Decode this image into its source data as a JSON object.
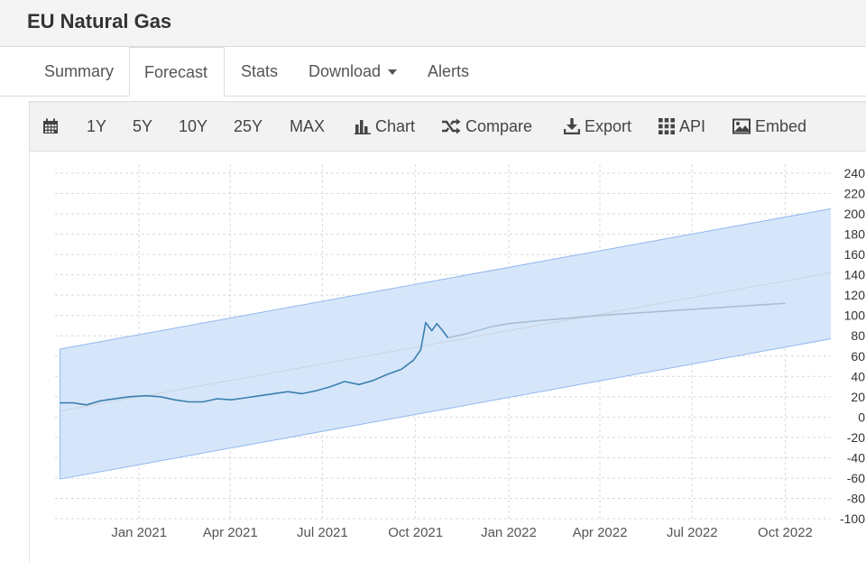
{
  "header": {
    "title": "EU Natural Gas"
  },
  "tabs": [
    {
      "label": "Summary",
      "active": false
    },
    {
      "label": "Forecast",
      "active": true
    },
    {
      "label": "Stats",
      "active": false
    },
    {
      "label": "Download",
      "active": false
    },
    {
      "label": "Alerts",
      "active": false
    }
  ],
  "toolbar": {
    "calendar_icon": "calendar-icon",
    "ranges": [
      "1Y",
      "5Y",
      "10Y",
      "25Y",
      "MAX"
    ],
    "chart_label": "Chart",
    "compare_label": "Compare",
    "export_label": "Export",
    "api_label": "API",
    "embed_label": "Embed"
  },
  "colors": {
    "band_fill": "#d6e6fa",
    "band_stroke": "#8fb8ee",
    "history_line": "#3a7fb0",
    "forecast_line": "#a9bfd4",
    "trend_line": "#c9d3dd",
    "grid": "#d9d9d9"
  },
  "chart_data": {
    "type": "line",
    "x_ticks": [
      "Jan 2021",
      "Apr 2021",
      "Jul 2021",
      "Oct 2021",
      "Jan 2022",
      "Apr 2022",
      "Jul 2022",
      "Oct 2022"
    ],
    "x_tick_dates": [
      "2021-01-01",
      "2021-04-01",
      "2021-07-01",
      "2021-10-01",
      "2022-01-01",
      "2022-04-01",
      "2022-07-01",
      "2022-10-01"
    ],
    "y_ticks": [
      240,
      220,
      200,
      180,
      160,
      140,
      120,
      100,
      80,
      60,
      40,
      20,
      0,
      -20,
      -40,
      -60,
      -80,
      -100
    ],
    "ylim": [
      -100,
      240
    ],
    "xlim": [
      "2020-10-10",
      "2022-11-15"
    ],
    "grid": true,
    "series": [
      {
        "role": "history",
        "x": [
          "2020-10-15",
          "2020-10-28",
          "2020-11-10",
          "2020-11-24",
          "2020-12-08",
          "2020-12-22",
          "2021-01-08",
          "2021-01-22",
          "2021-02-05",
          "2021-02-19",
          "2021-03-05",
          "2021-03-19",
          "2021-04-02",
          "2021-04-16",
          "2021-04-30",
          "2021-05-14",
          "2021-05-28",
          "2021-06-11",
          "2021-06-25",
          "2021-07-09",
          "2021-07-23",
          "2021-08-06",
          "2021-08-20",
          "2021-09-03",
          "2021-09-17",
          "2021-09-29",
          "2021-10-06",
          "2021-10-11",
          "2021-10-17",
          "2021-10-22",
          "2021-10-27",
          "2021-11-02"
        ],
        "y": [
          14,
          14,
          12,
          16,
          18,
          20,
          21,
          20,
          17,
          15,
          15,
          18,
          17,
          19,
          21,
          23,
          25,
          23,
          26,
          30,
          35,
          32,
          36,
          42,
          47,
          56,
          66,
          93,
          85,
          92,
          86,
          78
        ]
      },
      {
        "role": "forecast",
        "x": [
          "2021-11-02",
          "2021-11-20",
          "2021-12-15",
          "2022-01-01",
          "2022-02-01",
          "2022-04-01",
          "2022-07-01",
          "2022-10-01"
        ],
        "y": [
          78,
          82,
          89,
          92,
          95,
          100,
          106,
          112
        ]
      },
      {
        "role": "trend",
        "x": [
          "2020-10-15",
          "2022-11-15"
        ],
        "y": [
          6,
          142
        ]
      },
      {
        "role": "upper_band",
        "x": [
          "2020-10-15",
          "2022-11-15"
        ],
        "y": [
          67,
          205
        ]
      },
      {
        "role": "lower_band",
        "x": [
          "2020-10-15",
          "2022-11-15"
        ],
        "y": [
          -61,
          77
        ]
      }
    ]
  }
}
